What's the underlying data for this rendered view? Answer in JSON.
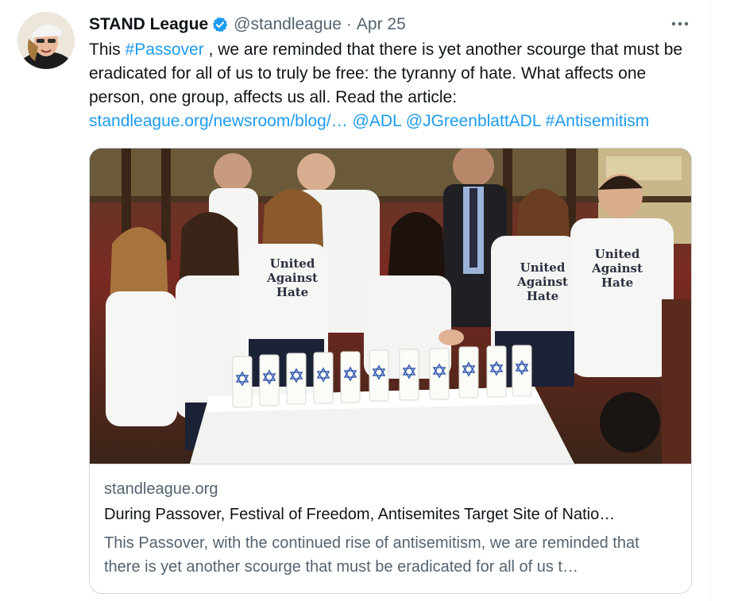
{
  "tweet": {
    "author_name": "STAND League",
    "handle": "@standleague",
    "separator": "·",
    "date": "Apr 25",
    "more_label": "•••",
    "text_parts": {
      "p1": "This ",
      "hashtag_passover": "#Passover",
      "p2": " , we are reminded that there is yet another scourge that must be eradicated for all of us to truly be free: the tyranny of hate. What affects one person, one group, affects us all. Read the article: ",
      "url": "standleague.org/newsroom/blog/…",
      "mention_adl": "@ADL",
      "mention_greenblatt": "@JGreenblattADL",
      "hashtag_antisemitism": "#Antisemitism"
    }
  },
  "card": {
    "domain": "standleague.org",
    "title": "During Passover, Festival of Freedom, Antisemites Target Site of Natio…",
    "description": "This Passover, with the continued rise of antisemitism, we are reminded that there is yet another scourge that must be eradicated for all of us t…",
    "shirt_text": [
      "United",
      "Against",
      "Hate"
    ]
  },
  "colors": {
    "link": "#1d9bf0",
    "secondary_text": "#536471",
    "primary_text": "#0f1419",
    "verified_badge": "#1d9bf0"
  },
  "icons": {
    "verified": "verified-badge-icon",
    "more": "more-options-icon"
  }
}
